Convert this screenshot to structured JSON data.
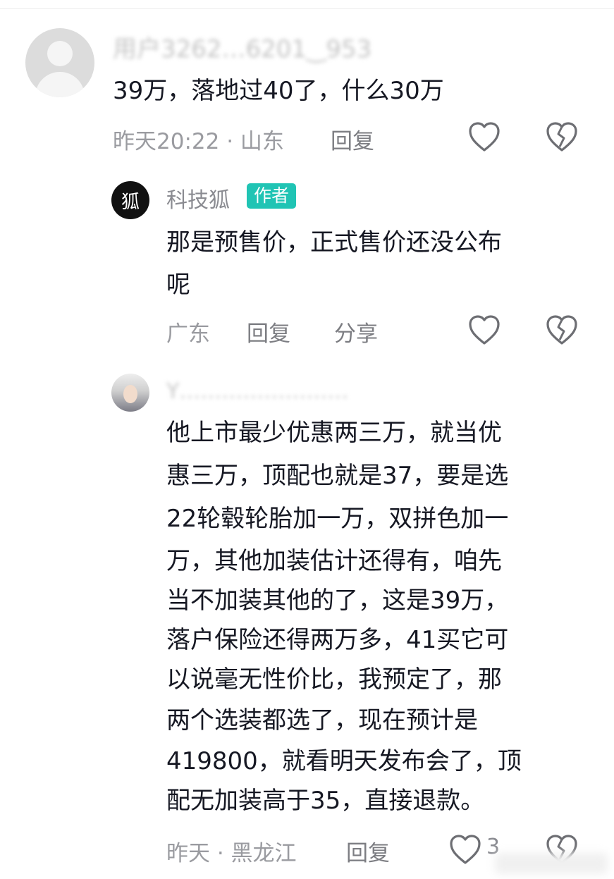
{
  "comments": [
    {
      "username": "用户3262…6201‿953",
      "text_lines": [
        "39万，落地过40了，什么30万"
      ],
      "meta": "昨天20:22 · 山东",
      "reply_label": "回复",
      "like_icon": "heart-outline-icon",
      "dislike_icon": "broken-heart-icon"
    },
    {
      "avatar_glyph": "狐",
      "username": "科技狐",
      "badge": "作者",
      "text_lines": [
        "那是预售价，正式售价还没公布",
        "呢"
      ],
      "meta": "广东",
      "reply_label": "回复",
      "share_label": "分享",
      "like_icon": "heart-outline-icon",
      "dislike_icon": "broken-heart-icon"
    },
    {
      "username": "Y……………………",
      "text_lines": [
        "他上市最少优惠两三万，就当优",
        "惠三万，顶配也就是37，要是选",
        "22轮毂轮胎加一万，双拼色加一",
        "万，其他加装估计还得有，咱先",
        "当不加装其他的了，这是39万，",
        "落户保险还得两万多，41买它可",
        "以说毫无性价比，我预定了，那",
        "两个选装都选了，现在预计是",
        "419800，就看明天发布会了，顶",
        "配无加装高于35，直接退款。"
      ],
      "meta": "昨天 · 黑龙江",
      "reply_label": "回复",
      "like_count": "3",
      "like_icon": "heart-outline-icon",
      "dislike_icon": "broken-heart-icon"
    }
  ],
  "colors": {
    "badge_bg": "#20c4b4",
    "text": "#161823",
    "meta": "#9a9ba0"
  }
}
